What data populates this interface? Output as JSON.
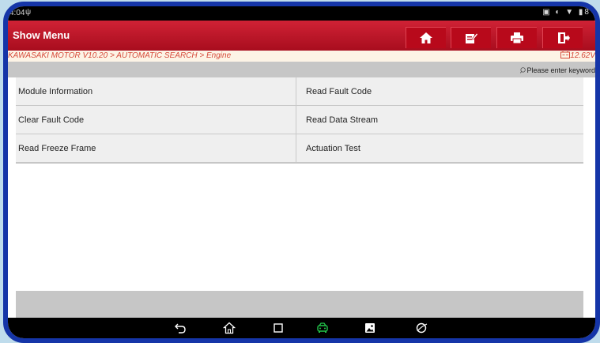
{
  "statusbar": {
    "time": "4:04",
    "right_icons": "▣ ◐ ▼ ▮8"
  },
  "header": {
    "title": "Show Menu",
    "buttons": [
      "home-icon",
      "edit-icon",
      "print-icon",
      "exit-icon"
    ]
  },
  "breadcrumb": {
    "path": "KAWASAKI MOTOR V10.20 > AUTOMATIC SEARCH > Engine",
    "voltage": "12.62V"
  },
  "search": {
    "placeholder": "Please enter keyword"
  },
  "menu": {
    "items": [
      "Module Information",
      "Read Fault Code",
      "Clear Fault Code",
      "Read Data Stream",
      "Read Freeze Frame",
      "Actuation Test"
    ]
  },
  "navbar": {
    "icons": [
      "back-icon",
      "home-icon",
      "recents-icon",
      "diagnostic-icon",
      "gallery-icon",
      "browser-icon"
    ],
    "active_color": "#22c54a"
  },
  "colors": {
    "brand": "#c8182b",
    "frame": "#1535a8",
    "breadcrumb_text": "#d64a3a"
  }
}
